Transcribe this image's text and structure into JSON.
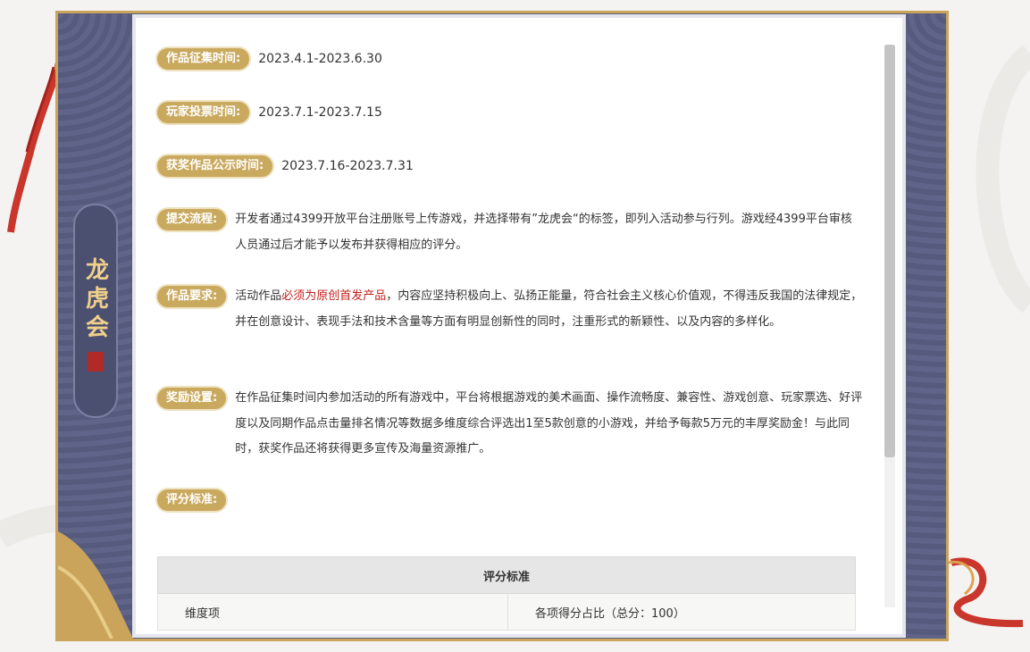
{
  "banner": {
    "title": "龙虎会"
  },
  "rows": [
    {
      "label": "作品征集时间:",
      "value": "2023.4.1-2023.6.30"
    },
    {
      "label": "玩家投票时间:",
      "value": "2023.7.1-2023.7.15"
    },
    {
      "label": "获奖作品公示时间:",
      "value": "2023.7.16-2023.7.31"
    }
  ],
  "submit": {
    "label": "提交流程:",
    "text": "开发者通过4399开放平台注册账号上传游戏，并选择带有”龙虎会“的标签，即列入活动参与行列。游戏经4399平台审核人员通过后才能予以发布并获得相应的评分。"
  },
  "requirements": {
    "label": "作品要求:",
    "text_before": "活动作品",
    "text_highlight": "必须为原创首发产品",
    "text_after": "，内容应坚持积极向上、弘扬正能量，符合社会主义核心价值观，不得违反我国的法律规定，并在创意设计、表现手法和技术含量等方面有明显创新性的同时，注重形式的新颖性、以及内容的多样化。",
    "highlight_color": "#c0201c"
  },
  "rewards": {
    "label": "奖励设置:",
    "text": "在作品征集时间内参加活动的所有游戏中，平台将根据游戏的美术画面、操作流畅度、兼容性、游戏创意、玩家票选、好评度以及同期作品点击量排名情况等数据多维度综合评选出1至5款创意的小游戏，并给予每款5万元的丰厚奖励金！与此同时，获奖作品还将获得更多宣传及海量资源推广。"
  },
  "scoring": {
    "label": "评分标准:",
    "table_title": "评分标准",
    "col1": "维度项",
    "col2": "各项得分占比（总分：100）"
  },
  "colors": {
    "frame": "#5a5f82",
    "gold": "#c9a95e",
    "tassel": "#c9362b"
  }
}
